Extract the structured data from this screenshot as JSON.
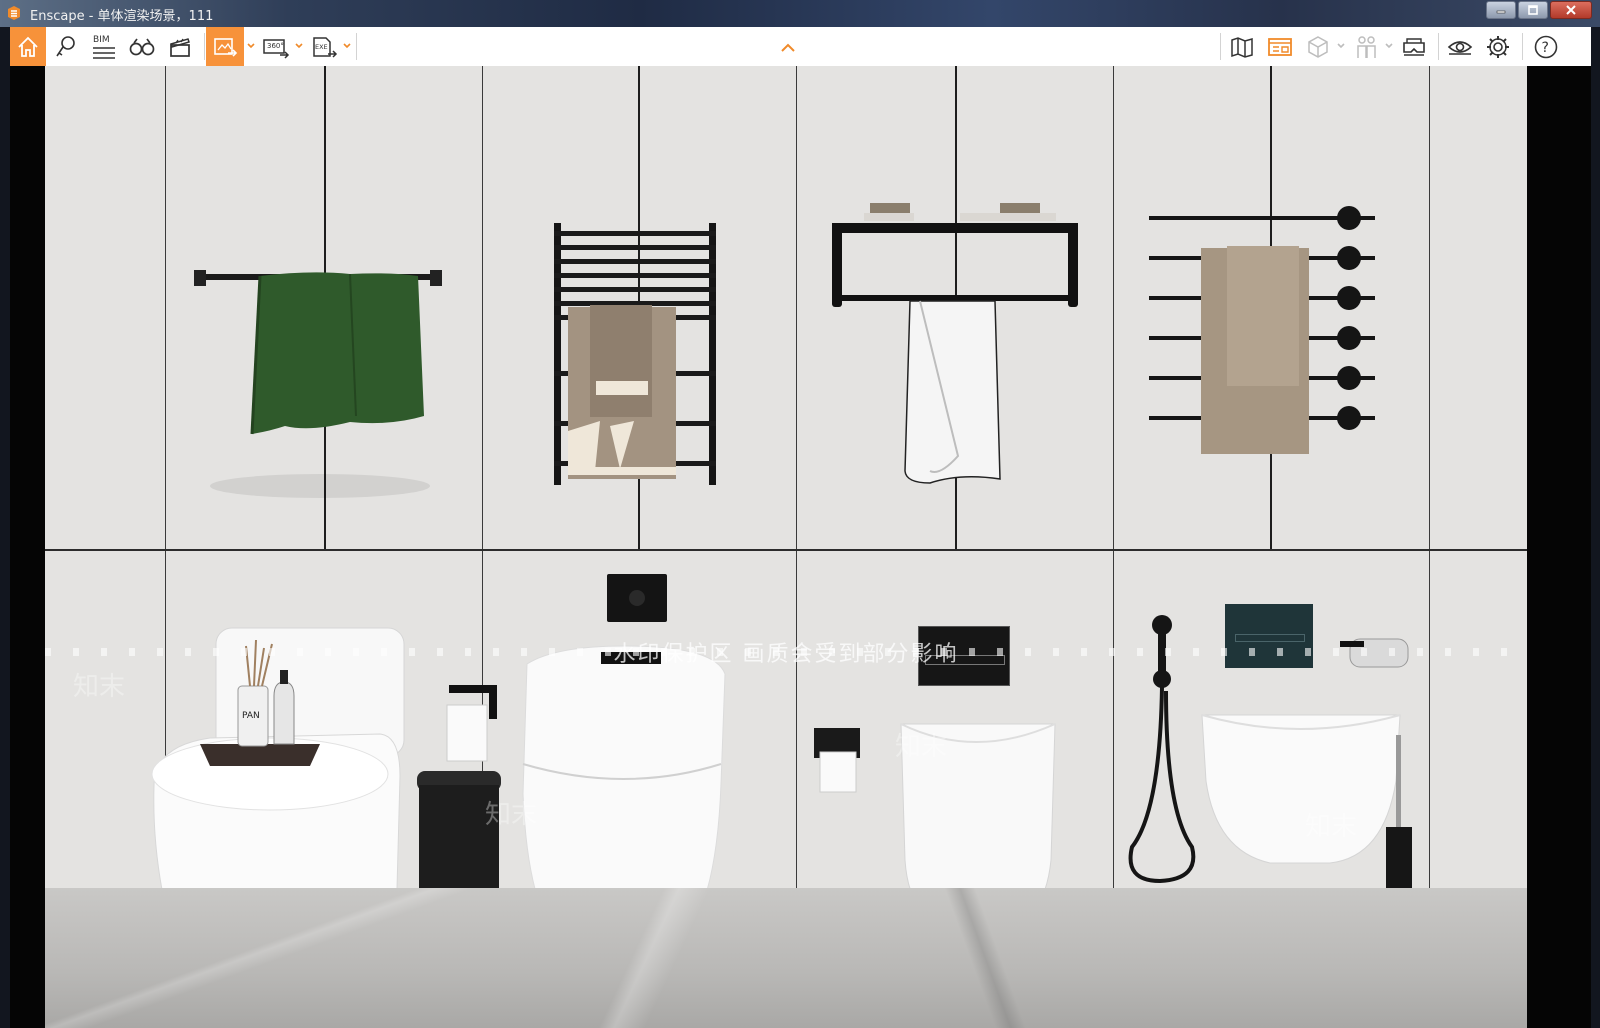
{
  "window": {
    "title": "Enscape - 单体渲染场景，111",
    "controls": [
      "minimize-icon",
      "maximize-icon",
      "close-icon"
    ]
  },
  "toolbar": {
    "left_tools": [
      {
        "name": "home-button",
        "icon": "home-icon",
        "active": true
      },
      {
        "name": "asset-library-button",
        "icon": "asset-library-icon"
      },
      {
        "name": "bim-button",
        "icon": "bim-icon",
        "label": "BIM"
      },
      {
        "name": "views-button",
        "icon": "binoculars-icon"
      },
      {
        "name": "video-editor-button",
        "icon": "clapperboard-icon"
      },
      {
        "name": "render-screenshot-button",
        "icon": "render-image-icon",
        "active": true,
        "dropdown": true
      },
      {
        "name": "render-panorama-button",
        "icon": "panorama-360-icon",
        "label": "360°",
        "dropdown": true
      },
      {
        "name": "export-button",
        "icon": "export-exe-icon",
        "label": "EXE",
        "dropdown": true
      }
    ],
    "center_toggle": "chevron-up-icon",
    "right_tools": [
      {
        "name": "map-button",
        "icon": "map-icon"
      },
      {
        "name": "capture-panel-button",
        "icon": "image-panel-icon"
      },
      {
        "name": "section-box-button",
        "icon": "cube-icon",
        "dropdown": true,
        "disabled": true
      },
      {
        "name": "collaboration-button",
        "icon": "people-icon",
        "dropdown": true,
        "disabled": true
      },
      {
        "name": "vr-headset-button",
        "icon": "vr-headset-icon"
      },
      {
        "name": "visual-settings-button",
        "icon": "eye-icon"
      },
      {
        "name": "general-settings-button",
        "icon": "gear-icon"
      },
      {
        "name": "help-button",
        "icon": "help-icon",
        "label": "?"
      }
    ]
  },
  "viewport": {
    "watermark_text": "水印保护区    画质会受到部分影响",
    "tile_watermark": "知末",
    "scene_labels": {
      "diffuser_label": "PAN"
    }
  },
  "colors": {
    "accent": "#f7923a",
    "wall": "#e4e3e1",
    "fixture_black": "#1a1a1a",
    "towel_green": "#2f5a2b",
    "towel_taupe": "#a39381",
    "flush_plate_teal": "#1f3539"
  }
}
